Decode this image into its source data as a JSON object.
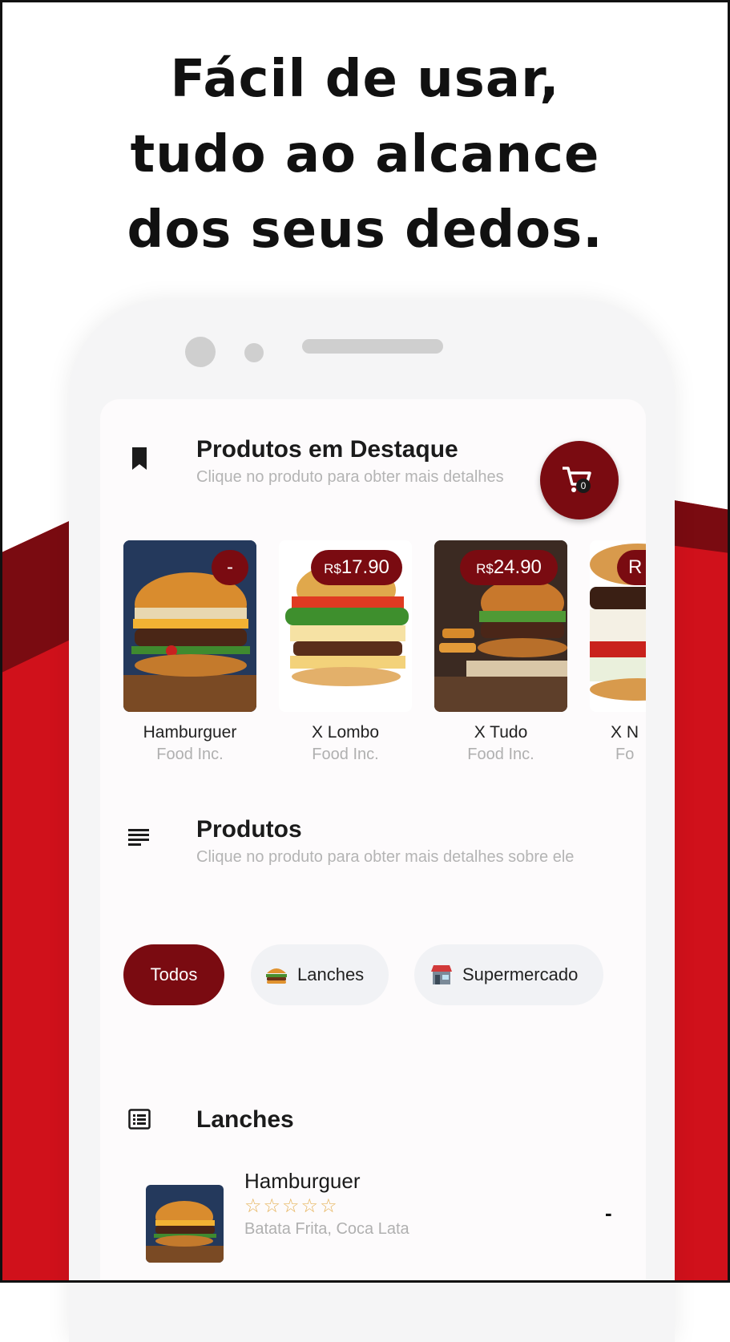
{
  "headline": {
    "line1": "Fácil de usar,",
    "line2": "tudo ao alcance",
    "line3": "dos seus dedos."
  },
  "colors": {
    "brand_dark_red": "#7a0b11",
    "background_red": "#d0111b",
    "chip_gray": "#f1f2f5"
  },
  "featured": {
    "icon": "bookmark-icon",
    "title": "Produtos em Destaque",
    "subtitle": "Clique no produto para obter mais detalhes",
    "cart": {
      "icon": "cart-icon",
      "count": "0"
    },
    "products": [
      {
        "name": "Hamburguer",
        "brand": "Food Inc.",
        "price": "-"
      },
      {
        "name": "X Lombo",
        "brand": "Food Inc.",
        "currency": "R$",
        "price": "17.90"
      },
      {
        "name": "X Tudo",
        "brand": "Food Inc.",
        "currency": "R$",
        "price": "24.90"
      },
      {
        "name": "X N",
        "brand": "Fo",
        "price": "R"
      }
    ]
  },
  "products_section": {
    "icon": "list-lines-icon",
    "title": "Produtos",
    "subtitle": "Clique no produto para obter mais detalhes sobre ele"
  },
  "categories": [
    {
      "label": "Todos",
      "active": true
    },
    {
      "label": "Lanches",
      "icon": "burger-icon"
    },
    {
      "label": "Supermercado",
      "icon": "store-icon"
    }
  ],
  "lanches": {
    "icon": "list-box-icon",
    "title": "Lanches",
    "items": [
      {
        "name": "Hamburguer",
        "stars": "☆☆☆☆☆",
        "description": "Batata Frita, Coca Lata",
        "price": "-"
      }
    ]
  }
}
